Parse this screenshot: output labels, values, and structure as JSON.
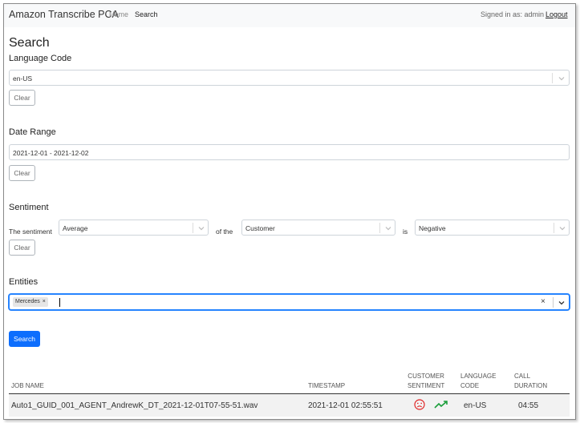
{
  "navbar": {
    "brand": "Amazon Transcribe PCA",
    "home": "Home",
    "search": "Search",
    "signed_in": "Signed in as: admin",
    "logout": "Logout"
  },
  "page": {
    "title": "Search"
  },
  "language": {
    "heading": "Language Code",
    "value": "en-US",
    "clear": "Clear"
  },
  "date_range": {
    "heading": "Date Range",
    "value": "2021-12-01 - 2021-12-02",
    "clear": "Clear"
  },
  "sentiment": {
    "heading": "Sentiment",
    "prefix": "The sentiment",
    "aggregate": "Average",
    "of_the": "of the",
    "party": "Customer",
    "is": "is",
    "direction": "Negative",
    "clear": "Clear"
  },
  "entities": {
    "heading": "Entities",
    "chips": [
      "Mercedes"
    ],
    "clear_icon": "×"
  },
  "search_button": "Search",
  "table": {
    "headers": {
      "job_name": "JOB NAME",
      "timestamp": "TIMESTAMP",
      "customer_sentiment": [
        "CUSTOMER",
        "SENTIMENT"
      ],
      "language_code": [
        "LANGUAGE",
        "CODE"
      ],
      "call_duration": [
        "CALL",
        "DURATION"
      ]
    },
    "rows": [
      {
        "job_name": "Auto1_GUID_001_AGENT_AndrewK_DT_2021-12-01T07-55-51.wav",
        "timestamp": "2021-12-01 02:55:51",
        "sentiment_icon": "sad-face-icon",
        "trend_icon": "trending-up-icon",
        "language_code": "en-US",
        "call_duration": "04:55"
      }
    ]
  },
  "colors": {
    "primary": "#0d6efd",
    "focus": "#2684ff",
    "negative": "#e02020",
    "positive": "#1a9e3a"
  }
}
